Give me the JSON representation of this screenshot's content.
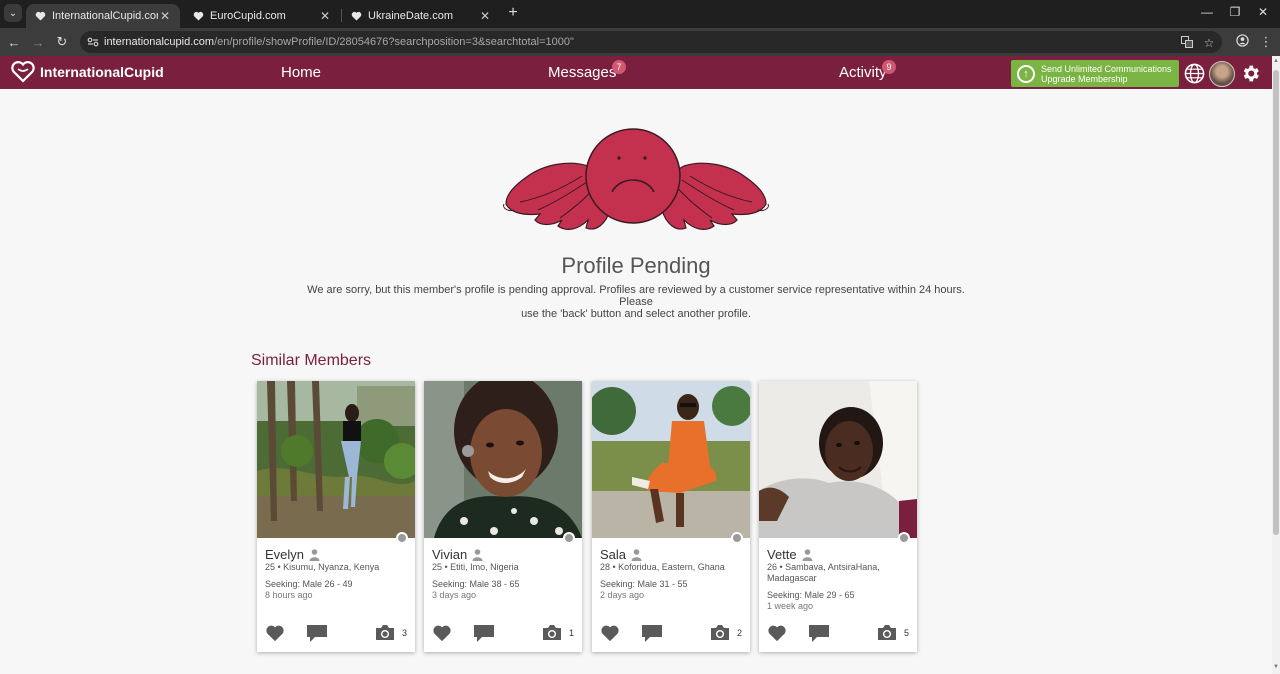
{
  "browser": {
    "tabs": [
      {
        "title": "InternationalCupid.com",
        "active": true
      },
      {
        "title": "EuroCupid.com",
        "active": false
      },
      {
        "title": "UkraineDate.com",
        "active": false
      }
    ],
    "url_host": "internationalcupid.com",
    "url_path": "/en/profile/showProfile/ID/28054676?searchposition=3&searchtotal=1000\""
  },
  "header": {
    "logo_text": "InternationalCupid",
    "nav": [
      {
        "label": "Home",
        "badge": ""
      },
      {
        "label": "Messages",
        "badge": "7"
      },
      {
        "label": "Activity",
        "badge": "9"
      }
    ],
    "upgrade_line1": "Send Unlimited Communications",
    "upgrade_line2": "Upgrade Membership"
  },
  "main": {
    "title": "Profile Pending",
    "message_line1": "We are sorry, but this member's profile is pending approval. Profiles are reviewed by a customer service representative within 24 hours. Please",
    "message_line2": "use the 'back' button and select another profile.",
    "similar_title": "Similar Members"
  },
  "members": [
    {
      "name": "Evelyn",
      "details": "25 • Kisumu, Nyanza, Kenya",
      "seeking": "Seeking: Male 26 - 49",
      "ago": "8 hours ago",
      "photos": "3"
    },
    {
      "name": "Vivian",
      "details": "25 • Etiti, Imo, Nigeria",
      "seeking": "Seeking: Male 38 - 65",
      "ago": "3 days ago",
      "photos": "1"
    },
    {
      "name": "Sala",
      "details": "28 • Koforidua, Eastern, Ghana",
      "seeking": "Seeking: Male 31 - 55",
      "ago": "2 days ago",
      "photos": "2"
    },
    {
      "name": "Vette",
      "details": "26 • Sambava, AntsiraHana, Madagascar",
      "seeking": "Seeking: Male 29 - 65",
      "ago": "1 week ago",
      "photos": "5"
    }
  ],
  "colors": {
    "brand": "#7a1f3d",
    "upgrade_green": "#7ab442",
    "badge": "#d0586f",
    "mascot": "#c4314f"
  },
  "icons": [
    "heart-icon",
    "chat-bubble-icon",
    "camera-icon",
    "person-icon",
    "globe-icon",
    "gear-icon",
    "upload-arrow-icon"
  ]
}
